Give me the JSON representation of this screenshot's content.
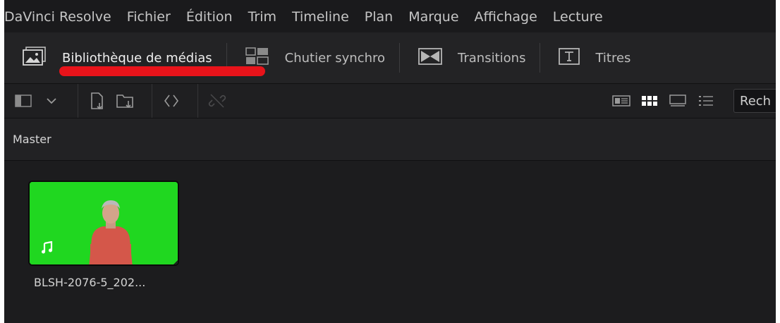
{
  "app_menu": {
    "items": [
      "DaVinci Resolve",
      "Fichier",
      "Édition",
      "Trim",
      "Timeline",
      "Plan",
      "Marque",
      "Affichage",
      "Lecture"
    ]
  },
  "panel_tabs": [
    {
      "label": "Bibliothèque de médias",
      "icon": "media-pool-icon",
      "active": true
    },
    {
      "label": "Chutier synchro",
      "icon": "sync-bin-icon",
      "active": false
    },
    {
      "label": "Transitions",
      "icon": "transitions-icon",
      "active": false
    },
    {
      "label": "Titres",
      "icon": "titles-icon",
      "active": false
    }
  ],
  "toolbar": {
    "left_icons": [
      "panel-toggle-icon",
      "chevron-down-icon",
      "import-media-icon",
      "import-folder-icon",
      "sync-icon",
      "unlink-icon"
    ],
    "view_icons": [
      "metadata-view-icon",
      "thumbnail-view-icon",
      "filmstrip-view-icon",
      "list-view-icon"
    ],
    "search_placeholder": "Rech"
  },
  "bin": {
    "path_label": "Master"
  },
  "clips": [
    {
      "name": "BLSH-2076-5_202...",
      "has_audio": true,
      "thumbnail_color": "#22dd22"
    }
  ],
  "colors": {
    "annotation_underline": "#e8131a",
    "background": "#1c1c1e",
    "green_screen": "#22dd22"
  }
}
